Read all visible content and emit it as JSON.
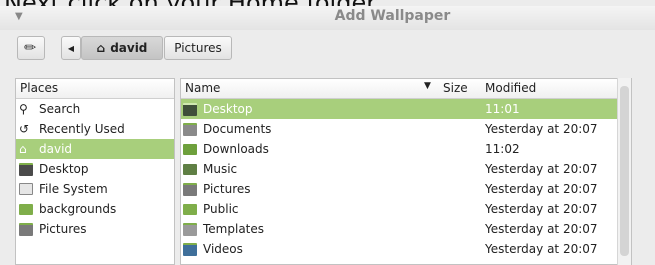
{
  "caption": "Next click on your Home folder",
  "window": {
    "title": "Add Wallpaper"
  },
  "path_bar": {
    "home_label": "david",
    "crumb": "Pictures"
  },
  "places": {
    "header": "Places",
    "items": [
      {
        "label": "Search",
        "icon": "search-icon"
      },
      {
        "label": "Recently Used",
        "icon": "recent-icon"
      },
      {
        "label": "david",
        "icon": "home-icon",
        "selected": true
      },
      {
        "label": "Desktop",
        "icon": "desktop-icon"
      },
      {
        "label": "File System",
        "icon": "drive-icon"
      },
      {
        "label": "backgrounds",
        "icon": "folder-icon"
      },
      {
        "label": "Pictures",
        "icon": "pictures-folder-icon"
      }
    ]
  },
  "files": {
    "columns": {
      "name": "Name",
      "size": "Size",
      "modified": "Modified"
    },
    "rows": [
      {
        "name": "Desktop",
        "modified": "11:01",
        "selected": true
      },
      {
        "name": "Documents",
        "modified": "Yesterday at 20:07"
      },
      {
        "name": "Downloads",
        "modified": "11:02"
      },
      {
        "name": "Music",
        "modified": "Yesterday at 20:07"
      },
      {
        "name": "Pictures",
        "modified": "Yesterday at 20:07"
      },
      {
        "name": "Public",
        "modified": "Yesterday at 20:07"
      },
      {
        "name": "Templates",
        "modified": "Yesterday at 20:07"
      },
      {
        "name": "Videos",
        "modified": "Yesterday at 20:07"
      }
    ]
  },
  "colors": {
    "selection": "#a8cf7c",
    "folder": "#7fae4a"
  }
}
